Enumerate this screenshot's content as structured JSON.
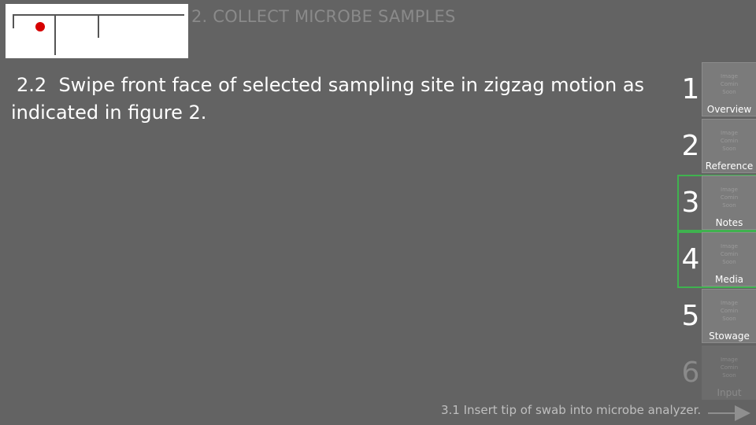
{
  "header": {
    "section_title": "2. COLLECT MICROBE SAMPLES"
  },
  "progress_map": {
    "current_marker_color": "#d60000"
  },
  "step": {
    "number": "2.2",
    "text": "Swipe front face of selected sampling site in zigzag motion as indicated in figure 2."
  },
  "sidebar": {
    "tabs": [
      {
        "number": "1",
        "label": "Overview",
        "placeholder": [
          "Image",
          "Comin",
          "Soon"
        ],
        "state": "normal"
      },
      {
        "number": "2",
        "label": "Reference",
        "placeholder": [
          "Image",
          "Comin",
          "Soon"
        ],
        "state": "normal"
      },
      {
        "number": "3",
        "label": "Notes",
        "placeholder": [
          "Image",
          "Comin",
          "Soon"
        ],
        "state": "active"
      },
      {
        "number": "4",
        "label": "Media",
        "placeholder": [
          "Image",
          "Comin",
          "Soon"
        ],
        "state": "active"
      },
      {
        "number": "5",
        "label": "Stowage",
        "placeholder": [
          "Image",
          "Comin",
          "Soon"
        ],
        "state": "normal"
      },
      {
        "number": "6",
        "label": "Input",
        "placeholder": [
          "Image",
          "Comin",
          "Soon"
        ],
        "state": "disabled"
      }
    ],
    "active_border_color": "#3fb24f"
  },
  "footer": {
    "next_step_text": "3.1  Insert tip of swab into microbe analyzer.",
    "next_icon": "arrow-right-icon"
  }
}
